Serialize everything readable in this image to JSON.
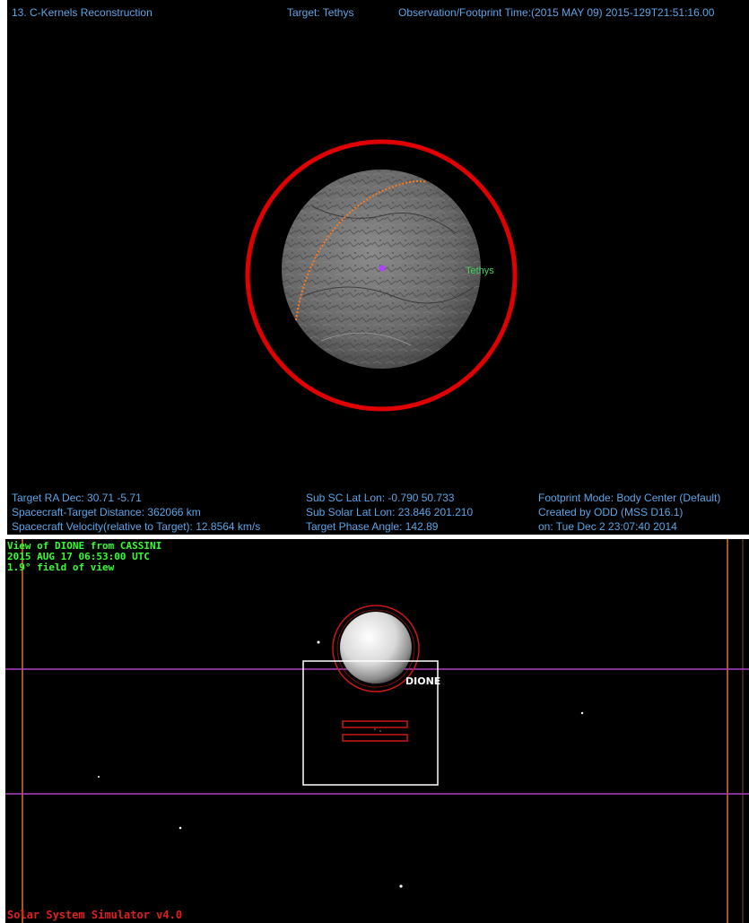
{
  "top": {
    "header": {
      "title": "13. C-Kernels Reconstruction",
      "target": "Target: Tethys",
      "time": "Observation/Footprint Time:(2015 MAY 09) 2015-129T21:51:16.00"
    },
    "body_label": "Tethys",
    "footer": {
      "left": [
        "Target RA Dec: 30.71  -5.71",
        "Spacecraft-Target Distance:  362066 km",
        "Spacecraft Velocity(relative to Target): 12.8564 km/s"
      ],
      "middle": [
        "Sub SC Lat Lon: -0.790  50.733",
        "Sub Solar Lat Lon: 23.846  201.210",
        "Target Phase Angle: 142.89"
      ],
      "right": [
        "Footprint Mode: Body Center (Default)",
        "Created by ODD (MSS D16.1)",
        "on: Tue Dec  2 23:07:40 2014"
      ]
    },
    "colors": {
      "text": "#5aa5e6",
      "ring": "#e00000",
      "label": "#3fd25a",
      "marker": "#b040ff"
    }
  },
  "bottom": {
    "overlay": [
      "View of DIONE from CASSINI",
      "2015 AUG 17 06:53:00 UTC",
      "1.9° field of view"
    ],
    "body_label": "DIONE",
    "version": "Solar System Simulator v4.0",
    "colors": {
      "overlay_text": "#33ff33",
      "version_text": "#e02020",
      "frame": "#ffffff",
      "guide_lines": "#b040c0",
      "vertical_lines": "#e07030"
    }
  }
}
